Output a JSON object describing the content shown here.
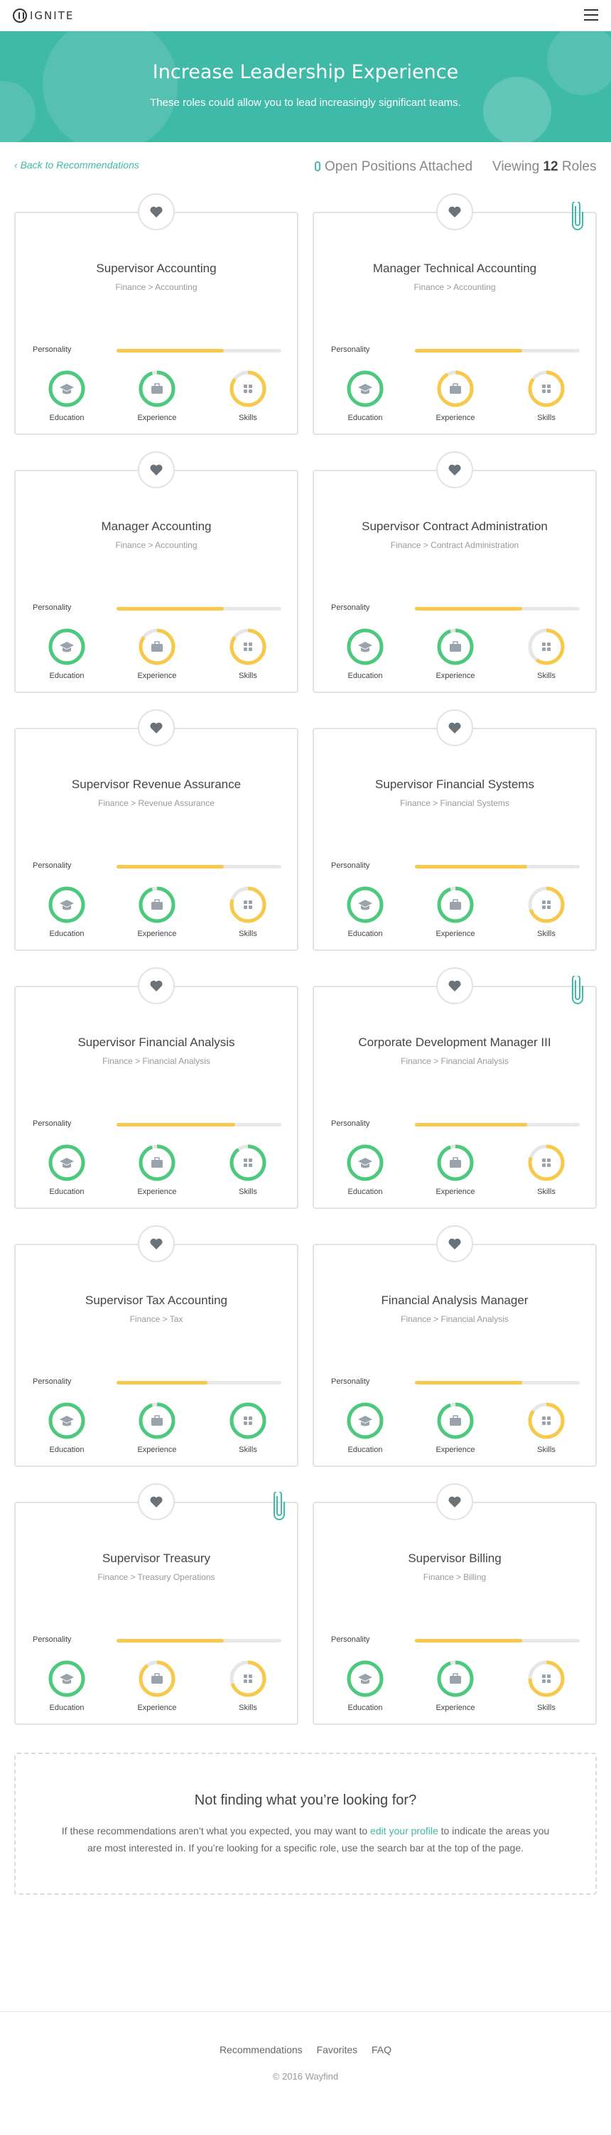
{
  "brand": {
    "logo_text": "IGNITE"
  },
  "hero": {
    "title": "Increase Leadership Experience",
    "subtitle": "These roles could allow you to lead increasingly significant teams."
  },
  "info": {
    "back_link": "Back to Recommendations",
    "open_positions": "Open Positions Attached",
    "viewing_prefix": "Viewing",
    "viewing_count": "12",
    "viewing_suffix": "Roles"
  },
  "labels": {
    "personality": "Personality",
    "education": "Education",
    "experience": "Experience",
    "skills": "Skills"
  },
  "colors": {
    "accent": "#3fb9a8",
    "green": "#4cc97c",
    "yellow": "#f7c94a",
    "ring_track": "#e6e6e6",
    "icon": "#9aa3ab"
  },
  "cards": [
    {
      "title": "Supervisor Accounting",
      "crumb": "Finance > Accounting",
      "attached": false,
      "personality": 0.65,
      "education": {
        "value": 1.0,
        "color": "green"
      },
      "experience": {
        "value": 0.95,
        "color": "green"
      },
      "skills": {
        "value": 0.85,
        "color": "yellow"
      }
    },
    {
      "title": "Manager Technical Accounting",
      "crumb": "Finance > Accounting",
      "attached": true,
      "personality": 0.65,
      "education": {
        "value": 1.0,
        "color": "green"
      },
      "experience": {
        "value": 0.92,
        "color": "yellow"
      },
      "skills": {
        "value": 0.85,
        "color": "yellow"
      }
    },
    {
      "title": "Manager Accounting",
      "crumb": "Finance > Accounting",
      "attached": false,
      "personality": 0.65,
      "education": {
        "value": 1.0,
        "color": "green"
      },
      "experience": {
        "value": 0.85,
        "color": "yellow"
      },
      "skills": {
        "value": 0.85,
        "color": "yellow"
      }
    },
    {
      "title": "Supervisor Contract Administration",
      "crumb": "Finance > Contract Administration",
      "attached": false,
      "personality": 0.65,
      "education": {
        "value": 1.0,
        "color": "green"
      },
      "experience": {
        "value": 0.95,
        "color": "green"
      },
      "skills": {
        "value": 0.6,
        "color": "yellow"
      }
    },
    {
      "title": "Supervisor Revenue Assurance",
      "crumb": "Finance > Revenue Assurance",
      "attached": false,
      "personality": 0.65,
      "education": {
        "value": 1.0,
        "color": "green"
      },
      "experience": {
        "value": 0.95,
        "color": "green"
      },
      "skills": {
        "value": 0.8,
        "color": "yellow"
      }
    },
    {
      "title": "Supervisor Financial Systems",
      "crumb": "Finance > Financial Systems",
      "attached": false,
      "personality": 0.68,
      "education": {
        "value": 1.0,
        "color": "green"
      },
      "experience": {
        "value": 0.95,
        "color": "green"
      },
      "skills": {
        "value": 0.7,
        "color": "yellow"
      }
    },
    {
      "title": "Supervisor Financial Analysis",
      "crumb": "Finance > Financial Analysis",
      "attached": false,
      "personality": 0.72,
      "education": {
        "value": 1.0,
        "color": "green"
      },
      "experience": {
        "value": 0.95,
        "color": "green"
      },
      "skills": {
        "value": 0.9,
        "color": "green"
      }
    },
    {
      "title": "Corporate Development Manager III",
      "crumb": "Finance > Financial Analysis",
      "attached": true,
      "personality": 0.68,
      "education": {
        "value": 1.0,
        "color": "green"
      },
      "experience": {
        "value": 0.95,
        "color": "green"
      },
      "skills": {
        "value": 0.8,
        "color": "yellow"
      }
    },
    {
      "title": "Supervisor Tax Accounting",
      "crumb": "Finance > Tax",
      "attached": false,
      "personality": 0.55,
      "education": {
        "value": 1.0,
        "color": "green"
      },
      "experience": {
        "value": 0.95,
        "color": "green"
      },
      "skills": {
        "value": 1.0,
        "color": "green"
      }
    },
    {
      "title": "Financial Analysis Manager",
      "crumb": "Finance > Financial Analysis",
      "attached": false,
      "personality": 0.65,
      "education": {
        "value": 1.0,
        "color": "green"
      },
      "experience": {
        "value": 0.95,
        "color": "green"
      },
      "skills": {
        "value": 0.85,
        "color": "yellow"
      }
    },
    {
      "title": "Supervisor Treasury",
      "crumb": "Finance > Treasury Operations",
      "attached": true,
      "personality": 0.65,
      "education": {
        "value": 1.0,
        "color": "green"
      },
      "experience": {
        "value": 0.9,
        "color": "yellow"
      },
      "skills": {
        "value": 0.7,
        "color": "yellow"
      }
    },
    {
      "title": "Supervisor Billing",
      "crumb": "Finance > Billing",
      "attached": false,
      "personality": 0.65,
      "education": {
        "value": 1.0,
        "color": "green"
      },
      "experience": {
        "value": 0.95,
        "color": "green"
      },
      "skills": {
        "value": 0.75,
        "color": "yellow"
      }
    }
  ],
  "not_finding": {
    "title": "Not finding what you’re looking for?",
    "text_before": "If these recommendations aren’t what you expected, you may want to ",
    "link": "edit your profile",
    "text_after": " to indicate the areas you are most interested in. If you’re looking for a specific role, use the search bar at the top of the page."
  },
  "footer": {
    "links": [
      "Recommendations",
      "Favorites",
      "FAQ"
    ],
    "copyright": "© 2016 Wayfind"
  }
}
